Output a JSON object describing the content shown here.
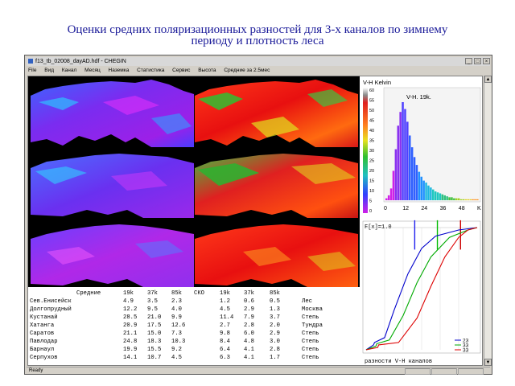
{
  "slide": {
    "title_line1": "Оценки средних поляризационных разностей для  3-х каналов по зимнему",
    "title_line2": "периоду и плотность леса"
  },
  "window": {
    "title": "f13_tb_02008_dayAD.hdf - CHEGIN",
    "controls": {
      "minimize": "_",
      "maximize": "□",
      "close": "×"
    }
  },
  "menu": [
    "File",
    "Вид",
    "Канал",
    "Месяц",
    "Наземка",
    "Статистика",
    "Сервис",
    "Высота",
    "Средние за 2.5мес"
  ],
  "colors": {
    "title_text": "#1a1a99",
    "stats_text": "#000000",
    "cdf_lines": [
      "#0000cc",
      "#00aa00",
      "#dd0000"
    ],
    "cdf_vlines": [
      "#2020ee",
      "#00bb00",
      "#cc0000"
    ]
  },
  "scale_panel": {
    "title": "V-H Kelvin",
    "colorbar_ticks": [
      "60",
      "55",
      "50",
      "45",
      "40",
      "35",
      "30",
      "25",
      "20",
      "15",
      "10",
      "5",
      "0"
    ],
    "histogram_label": "V-H. 19k.",
    "histogram_x_ticks": [
      "0",
      "12",
      "24",
      "36",
      "48",
      "K"
    ]
  },
  "chart_data": [
    {
      "type": "bar",
      "title": "V-H. 19k.",
      "xlabel": "",
      "ylabel": "",
      "x_ticks": [
        "0",
        "12",
        "24",
        "36",
        "48",
        "K"
      ],
      "values": [
        2,
        5,
        12,
        30,
        52,
        76,
        90,
        100,
        93,
        80,
        66,
        54,
        44,
        36,
        29,
        24,
        20,
        18,
        15,
        13,
        11,
        9,
        8,
        7,
        6,
        5,
        4,
        3,
        3,
        2,
        2,
        2,
        1,
        1,
        1,
        1,
        1,
        1,
        1,
        1
      ]
    },
    {
      "type": "line",
      "title": "F[x]=1.0",
      "xlabel": "разности V-H каналов",
      "series": [
        {
          "name": "23",
          "x": [
            0,
            1.6,
            1.8,
            4,
            6,
            9,
            12,
            15,
            20,
            24
          ],
          "y": [
            0,
            0.04,
            0.06,
            0.1,
            0.32,
            0.62,
            0.83,
            0.93,
            0.98,
            1.0
          ]
        },
        {
          "name": "33",
          "x": [
            0,
            2.1,
            2.3,
            5,
            8,
            11,
            14,
            18,
            22,
            24
          ],
          "y": [
            0,
            0.03,
            0.05,
            0.08,
            0.28,
            0.55,
            0.76,
            0.92,
            0.98,
            1.0
          ]
        },
        {
          "name": "33",
          "x": [
            0,
            2.5,
            2.7,
            7,
            11,
            14,
            17,
            20,
            22,
            24
          ],
          "y": [
            0,
            0.02,
            0.04,
            0.06,
            0.26,
            0.52,
            0.76,
            0.92,
            0.98,
            1.0
          ]
        }
      ],
      "vlines": [
        10.5,
        15.4,
        20.4
      ],
      "xlim": [
        0,
        24
      ],
      "ylim": [
        0,
        1.0
      ]
    }
  ],
  "cdf_panel": {
    "header": "F[x]=1.0",
    "xlabel": "разности V-H каналов",
    "legend": [
      "23",
      "33",
      "33"
    ]
  },
  "stats": {
    "headers": {
      "avg": "Средние",
      "c19": "19k",
      "c37": "37k",
      "c85": "85k",
      "sko": "СКО",
      "s19": "19k",
      "s37": "37k",
      "s85": "85k"
    },
    "rows": [
      {
        "name": "Сев.Енисейск",
        "m19": "4.9",
        "m37": "3.5",
        "m85": "2.3",
        "s19": "1.2",
        "s37": "0.6",
        "s85": "0.5",
        "cls": "Лес"
      },
      {
        "name": "Долгопрудный",
        "m19": "12.2",
        "m37": "9.5",
        "m85": "4.0",
        "s19": "4.5",
        "s37": "2.9",
        "s85": "1.3",
        "cls": "Москва"
      },
      {
        "name": "Кустанай",
        "m19": "28.5",
        "m37": "21.0",
        "m85": "9.9",
        "s19": "11.4",
        "s37": "7.9",
        "s85": "3.7",
        "cls": "Степь"
      },
      {
        "name": "Хатанга",
        "m19": "20.9",
        "m37": "17.5",
        "m85": "12.6",
        "s19": "2.7",
        "s37": "2.8",
        "s85": "2.0",
        "cls": "Тундра"
      },
      {
        "name": "Саратов",
        "m19": "21.1",
        "m37": "15.0",
        "m85": "7.3",
        "s19": "9.8",
        "s37": "6.0",
        "s85": "2.9",
        "cls": "Степь"
      },
      {
        "name": "Павлодар",
        "m19": "24.8",
        "m37": "18.3",
        "m85": "10.3",
        "s19": "8.4",
        "s37": "4.8",
        "s85": "3.0",
        "cls": "Степь"
      },
      {
        "name": "Барнаул",
        "m19": "19.9",
        "m37": "15.5",
        "m85": "9.2",
        "s19": "6.4",
        "s37": "4.1",
        "s85": "2.8",
        "cls": "Степь"
      },
      {
        "name": "Серпухов",
        "m19": "14.1",
        "m37": "10.7",
        "m85": "4.5",
        "s19": "6.3",
        "s37": "4.1",
        "s85": "1.7",
        "cls": "Степь"
      }
    ]
  },
  "statusbar": {
    "text": "Ready"
  }
}
